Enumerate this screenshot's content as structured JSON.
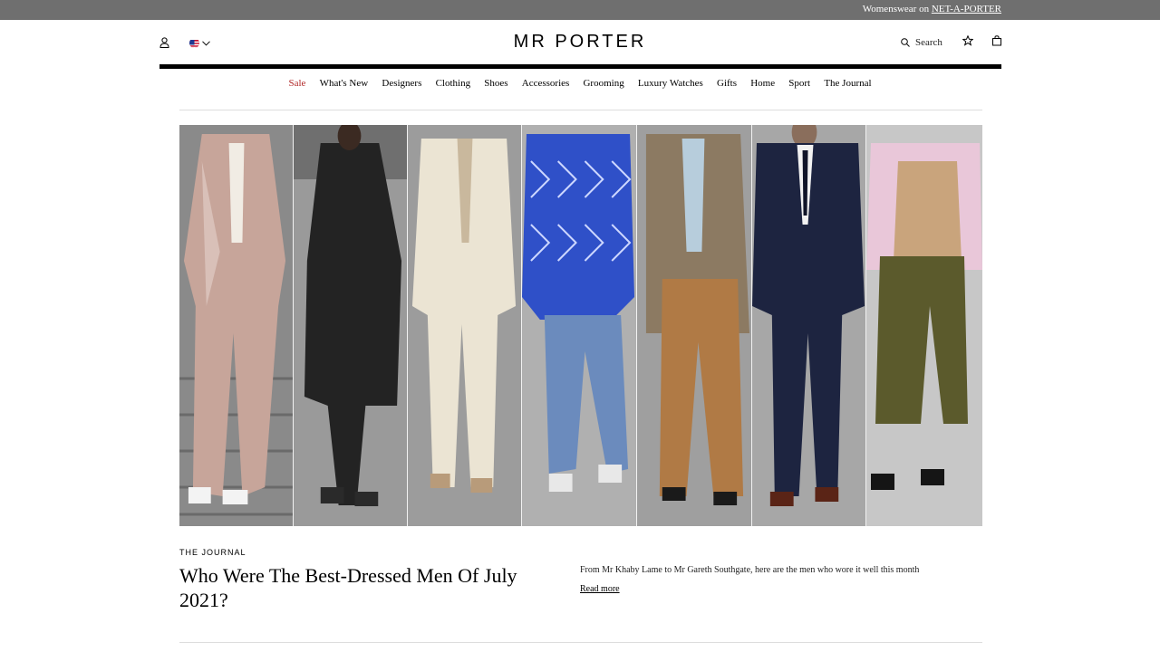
{
  "topbar": {
    "promo_prefix": "Womenswear on",
    "promo_link": "NET-A-PORTER"
  },
  "header": {
    "logo": "MR PORTER",
    "search_label": "Search",
    "icons": [
      "user-icon",
      "us-flag-icon",
      "chevron-down-icon",
      "search-icon",
      "star-icon",
      "bag-icon"
    ]
  },
  "nav": {
    "items": [
      {
        "label": "Sale"
      },
      {
        "label": "What's New"
      },
      {
        "label": "Designers"
      },
      {
        "label": "Clothing"
      },
      {
        "label": "Shoes"
      },
      {
        "label": "Accessories"
      },
      {
        "label": "Grooming"
      },
      {
        "label": "Luxury Watches"
      },
      {
        "label": "Gifts"
      },
      {
        "label": "Home"
      },
      {
        "label": "Sport"
      },
      {
        "label": "The Journal"
      }
    ],
    "sale_color": "#b22a2a"
  },
  "article": {
    "section": "THE JOURNAL",
    "title": "Who Were The Best-Dressed Men Of July 2021?",
    "standfirst": "From Mr Khaby Lame to Mr Gareth Southgate, here are the men who wore it well this month",
    "cta": "Read more"
  },
  "colors": {
    "topbar_bg": "#6f6f6f",
    "text": "#000000",
    "accent_sale": "#b22a2a"
  }
}
